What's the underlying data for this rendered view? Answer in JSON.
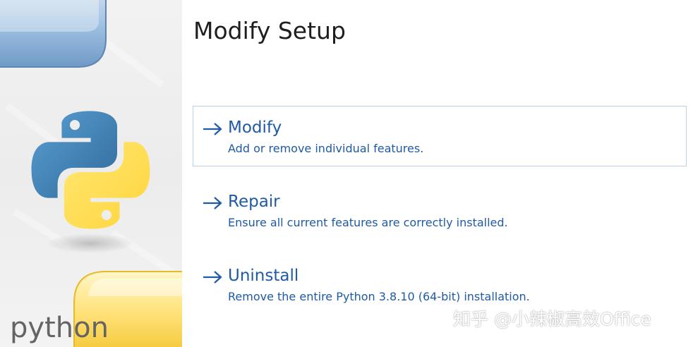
{
  "window": {
    "title": "Modify Setup"
  },
  "sidebar": {
    "brand": "python",
    "logo_icon": "python-logo-icon"
  },
  "options": [
    {
      "title": "Modify",
      "description": "Add or remove individual features.",
      "selected": true,
      "icon": "arrow-right-icon"
    },
    {
      "title": "Repair",
      "description": "Ensure all current features are correctly installed.",
      "selected": false,
      "icon": "arrow-right-icon"
    },
    {
      "title": "Uninstall",
      "description": "Remove the entire Python 3.8.10 (64-bit) installation.",
      "selected": false,
      "icon": "arrow-right-icon"
    }
  ],
  "watermark": "知乎 @小辣椒高效Office",
  "colors": {
    "accent": "#1f5aa6",
    "selected_border": "#b5d3ec",
    "python_blue": "#3a73a6",
    "python_yellow": "#f7d03e"
  }
}
